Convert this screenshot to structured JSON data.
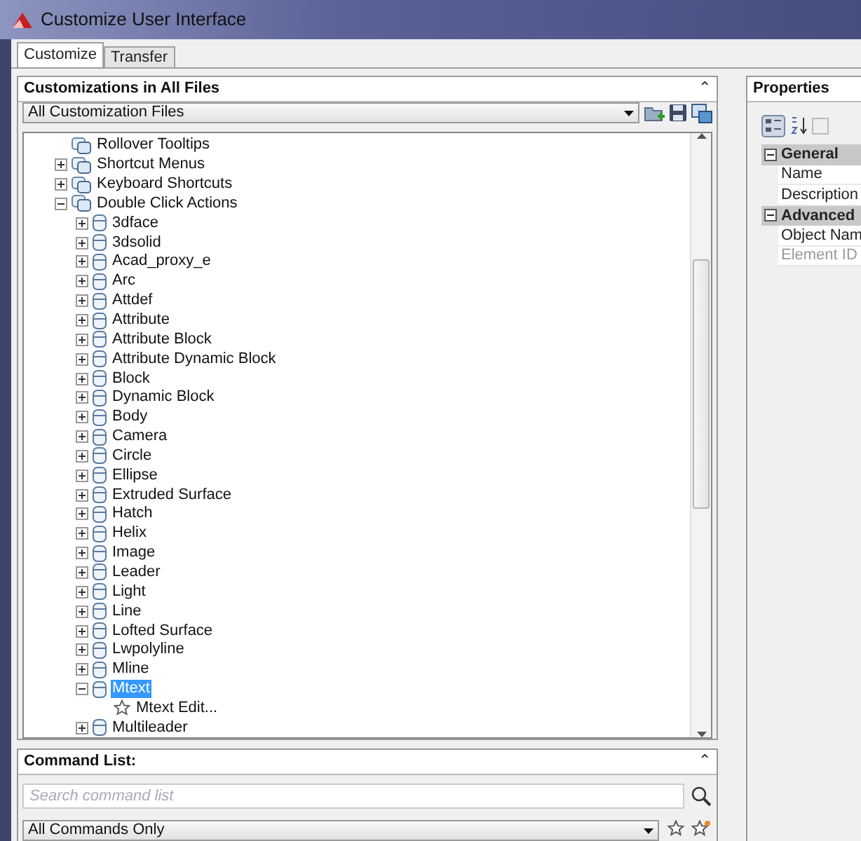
{
  "window": {
    "title": "Customize User Interface"
  },
  "tabs": [
    {
      "label": "Customize",
      "selected": true
    },
    {
      "label": "Transfer",
      "selected": false
    }
  ],
  "customizations_panel": {
    "title": "Customizations in All Files",
    "collapse_glyph": "⌃",
    "file_dropdown": {
      "value": "All Customization Files"
    },
    "tree": [
      {
        "label": "Rollover Tooltips",
        "kind": "leaf",
        "selected": false
      },
      {
        "label": "Shortcut Menus",
        "kind": "group",
        "expanded": false,
        "selected": false
      },
      {
        "label": "Keyboard Shortcuts",
        "kind": "group",
        "expanded": false,
        "selected": false
      },
      {
        "label": "Double Click Actions",
        "kind": "group",
        "expanded": true,
        "selected": false,
        "children": [
          {
            "label": "3dface",
            "kind": "group",
            "expanded": false,
            "selected": false
          },
          {
            "label": "3dsolid",
            "kind": "group",
            "expanded": false,
            "selected": false
          },
          {
            "label": "Acad_proxy_e",
            "kind": "group",
            "expanded": false,
            "selected": false
          },
          {
            "label": "Arc",
            "kind": "group",
            "expanded": false,
            "selected": false
          },
          {
            "label": "Attdef",
            "kind": "group",
            "expanded": false,
            "selected": false
          },
          {
            "label": "Attribute",
            "kind": "group",
            "expanded": false,
            "selected": false
          },
          {
            "label": "Attribute Block",
            "kind": "group",
            "expanded": false,
            "selected": false
          },
          {
            "label": "Attribute Dynamic Block",
            "kind": "group",
            "expanded": false,
            "selected": false
          },
          {
            "label": "Block",
            "kind": "group",
            "expanded": false,
            "selected": false
          },
          {
            "label": "Dynamic Block",
            "kind": "group",
            "expanded": false,
            "selected": false
          },
          {
            "label": "Body",
            "kind": "group",
            "expanded": false,
            "selected": false
          },
          {
            "label": "Camera",
            "kind": "group",
            "expanded": false,
            "selected": false
          },
          {
            "label": "Circle",
            "kind": "group",
            "expanded": false,
            "selected": false
          },
          {
            "label": "Ellipse",
            "kind": "group",
            "expanded": false,
            "selected": false
          },
          {
            "label": "Extruded Surface",
            "kind": "group",
            "expanded": false,
            "selected": false
          },
          {
            "label": "Hatch",
            "kind": "group",
            "expanded": false,
            "selected": false
          },
          {
            "label": "Helix",
            "kind": "group",
            "expanded": false,
            "selected": false
          },
          {
            "label": "Image",
            "kind": "group",
            "expanded": false,
            "selected": false
          },
          {
            "label": "Leader",
            "kind": "group",
            "expanded": false,
            "selected": false
          },
          {
            "label": "Light",
            "kind": "group",
            "expanded": false,
            "selected": false
          },
          {
            "label": "Line",
            "kind": "group",
            "expanded": false,
            "selected": false
          },
          {
            "label": "Lofted Surface",
            "kind": "group",
            "expanded": false,
            "selected": false
          },
          {
            "label": "Lwpolyline",
            "kind": "group",
            "expanded": false,
            "selected": false
          },
          {
            "label": "Mline",
            "kind": "group",
            "expanded": false,
            "selected": false
          },
          {
            "label": "Mtext",
            "kind": "group",
            "expanded": true,
            "selected": true,
            "children": [
              {
                "label": "Mtext Edit...",
                "kind": "leaf",
                "selected": false
              }
            ]
          },
          {
            "label": "Multileader",
            "kind": "group",
            "expanded": false,
            "selected": false
          }
        ]
      }
    ]
  },
  "command_list_panel": {
    "title": "Command List:",
    "collapse_glyph": "⌃",
    "search": {
      "placeholder": "Search command list"
    },
    "filter_dropdown": {
      "value": "All Commands Only"
    }
  },
  "properties_panel": {
    "title": "Properties",
    "categories": [
      {
        "label": "General",
        "expanded": true,
        "rows": [
          {
            "label": "Name",
            "disabled": false
          },
          {
            "label": "Description",
            "disabled": false
          }
        ]
      },
      {
        "label": "Advanced",
        "expanded": true,
        "rows": [
          {
            "label": "Object Nam",
            "disabled": false
          },
          {
            "label": "Element ID",
            "disabled": true
          }
        ]
      }
    ]
  }
}
